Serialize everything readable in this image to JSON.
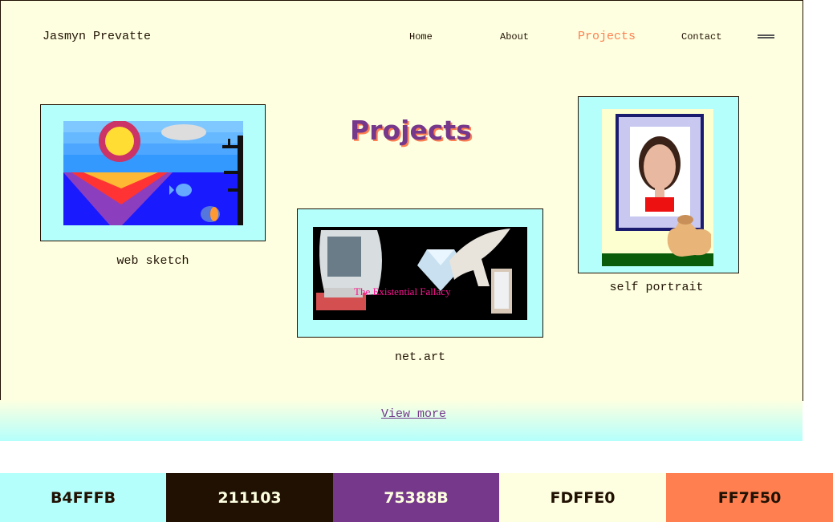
{
  "header": {
    "brand": "Jasmyn Prevatte",
    "nav": [
      {
        "label": "Home",
        "active": false
      },
      {
        "label": "About",
        "active": false
      },
      {
        "label": "Projects",
        "active": true
      },
      {
        "label": "Contact",
        "active": false
      }
    ],
    "menu_icon": "hamburger-menu-icon"
  },
  "main": {
    "title": "Projects",
    "projects": [
      {
        "caption": "web sketch"
      },
      {
        "caption": "net.art",
        "image_text": "The Existential Fallacy"
      },
      {
        "caption": "self portrait"
      }
    ],
    "view_more": "View more"
  },
  "palette": [
    {
      "hex": "B4FFFB",
      "color": "#B4FFFB",
      "text_color": "#211103"
    },
    {
      "hex": "211103",
      "color": "#211103",
      "text_color": "#FDFFE0"
    },
    {
      "hex": "75388B",
      "color": "#75388B",
      "text_color": "#FDFFE0"
    },
    {
      "hex": "FDFFE0",
      "color": "#FDFFE0",
      "text_color": "#211103"
    },
    {
      "hex": "FF7F50",
      "color": "#FF7F50",
      "text_color": "#211103"
    }
  ]
}
